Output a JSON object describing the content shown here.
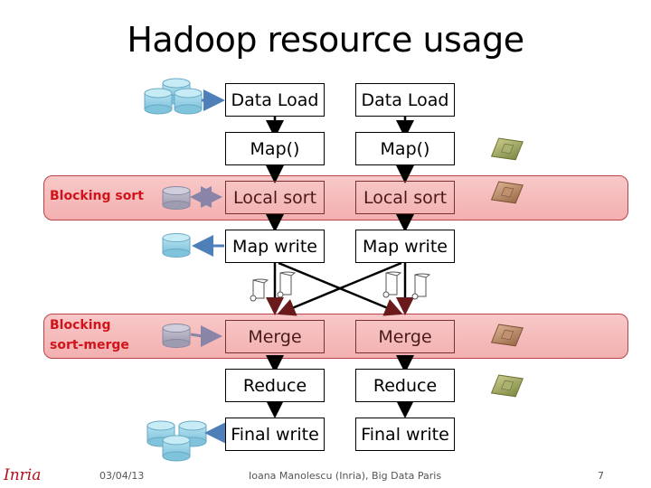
{
  "slide": {
    "title": "Hadoop resource usage",
    "bands": [
      {
        "label": "Blocking sort"
      },
      {
        "label_line1": "Blocking",
        "label_line2": "sort-merge"
      }
    ],
    "pipelines": [
      {
        "steps": [
          "Data Load",
          "Map()",
          "Local sort",
          "Map write",
          "Merge",
          "Reduce",
          "Final write"
        ]
      },
      {
        "steps": [
          "Data Load",
          "Map()",
          "Local sort",
          "Map write",
          "Merge",
          "Reduce",
          "Final write"
        ]
      }
    ],
    "icons": {
      "disk": "database-icon",
      "cpu": "cpu-chip-icon",
      "file": "scroll-file-icon"
    },
    "colors": {
      "band_fill": "#f5bcbc",
      "band_border": "#b8444a",
      "band_label": "#d0141c",
      "disk_blue": "#8ecfe4",
      "disk_gray": "#a9a7b8",
      "arrow_blue": "#4f7fb8",
      "arrow_gray": "#8a84a8"
    }
  },
  "footer": {
    "logo": "Inria",
    "date": "03/04/13",
    "author": "Ioana Manolescu (Inria), Big Data Paris",
    "page": "7"
  }
}
